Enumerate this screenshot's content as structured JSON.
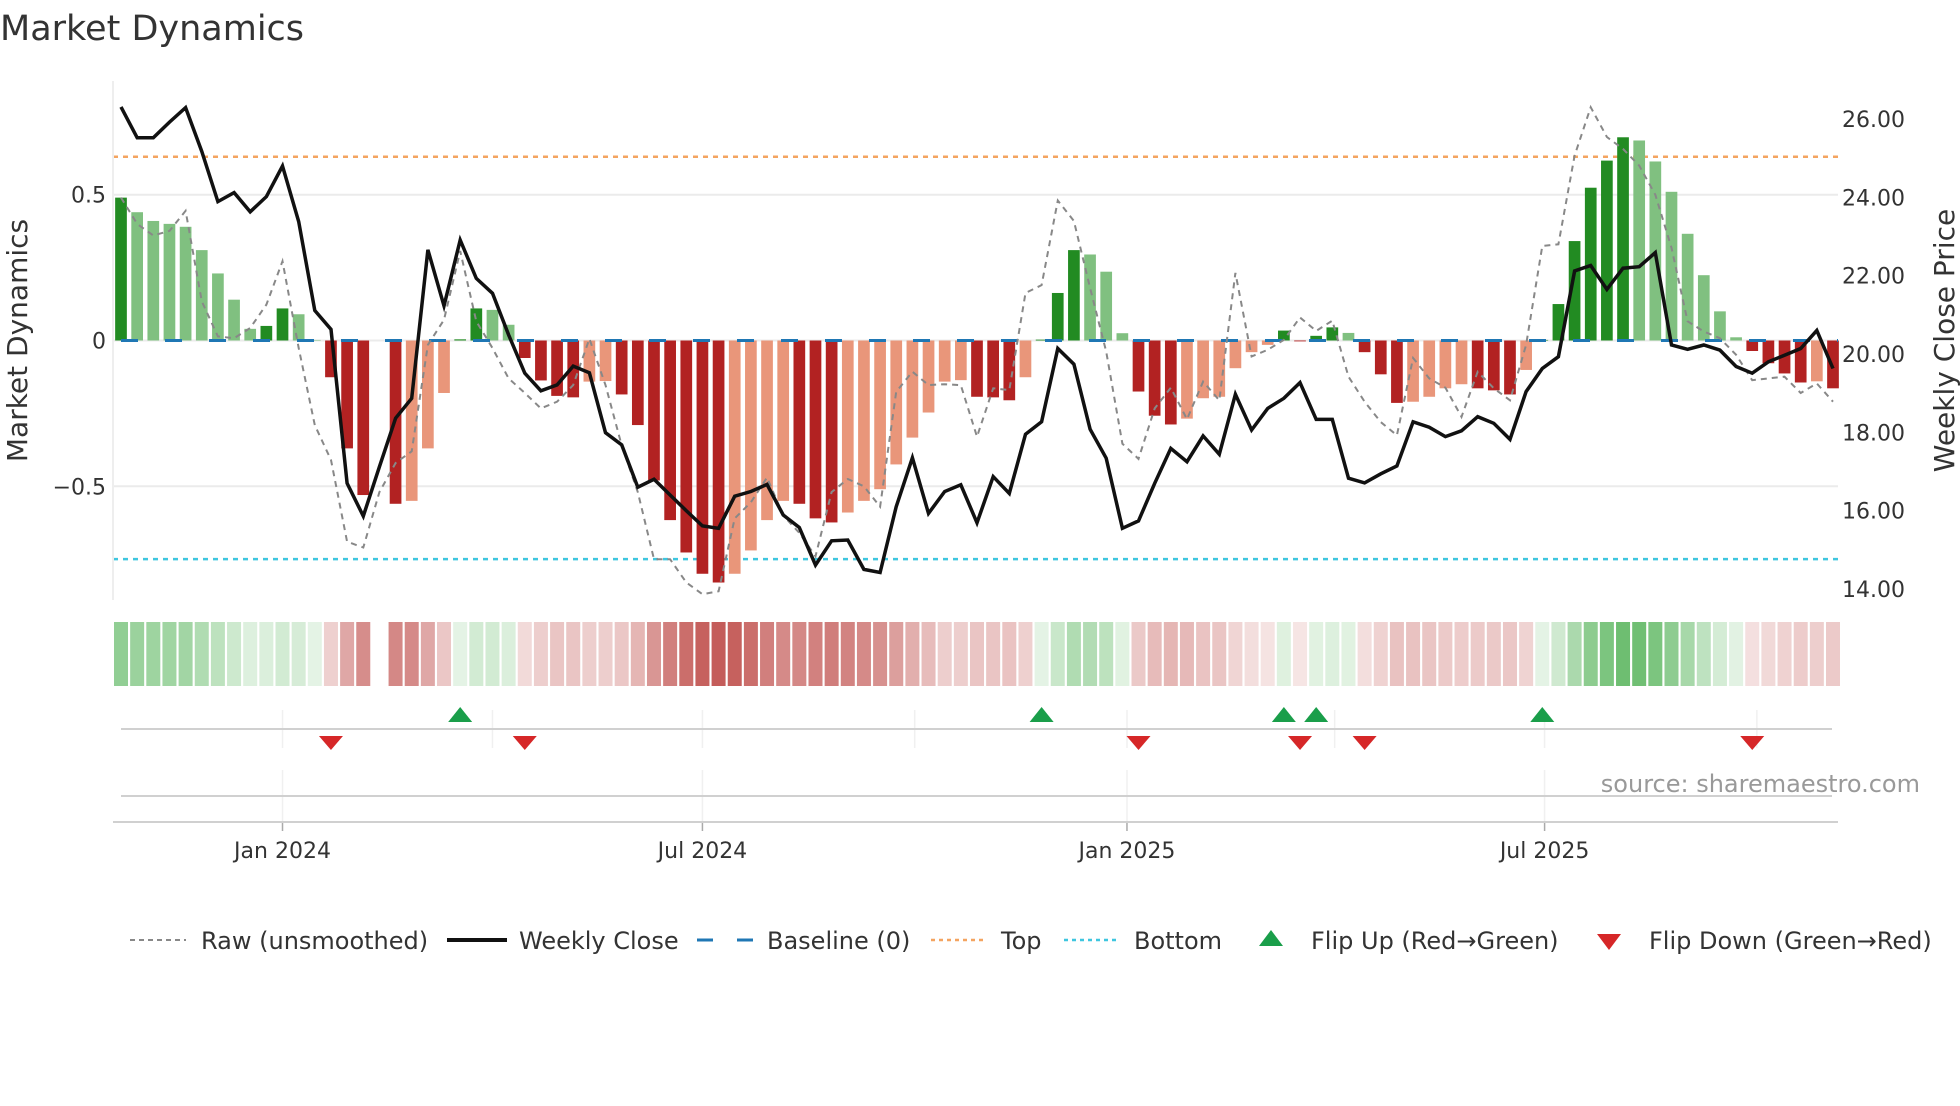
{
  "chart_data": {
    "type": "bar",
    "title": "Market Dynamics",
    "ylabel": "Market Dynamics",
    "ylabel_right": "Weekly Close Price",
    "ylim": [
      -0.89,
      0.89
    ],
    "ylim_right": [
      14.0,
      26.0
    ],
    "start_date": "2023-10-23",
    "frequency": "weekly",
    "left_ticks": [
      {
        "value": 0.5,
        "label": "0.5"
      },
      {
        "value": 0,
        "label": "0"
      },
      {
        "value": -0.5,
        "label": "−0.5"
      }
    ],
    "right_ticks": [
      {
        "value": 26,
        "label": "26.00"
      },
      {
        "value": 24,
        "label": "24.00"
      },
      {
        "value": 22,
        "label": "22.00"
      },
      {
        "value": 20,
        "label": "20.00"
      },
      {
        "value": 18,
        "label": "18.00"
      },
      {
        "value": 16,
        "label": "16.00"
      },
      {
        "value": 14,
        "label": "14.00"
      }
    ],
    "x_ticks": [
      {
        "date": "2024-01-01",
        "label": "Jan 2024"
      },
      {
        "date": "2024-07-01",
        "label": "Jul 2024"
      },
      {
        "date": "2025-01-01",
        "label": "Jan 2025"
      },
      {
        "date": "2025-07-01",
        "label": "Jul 2025"
      }
    ],
    "quarter_grid": [
      "2024-01-01",
      "2024-04-01",
      "2024-07-01",
      "2024-10-01",
      "2025-01-01",
      "2025-04-01",
      "2025-07-01",
      "2025-10-01"
    ],
    "top_level": 0.63,
    "bottom_level": -0.75,
    "baseline": 0,
    "series": [
      {
        "name": "Market Dynamics",
        "kind": "bar",
        "values": [
          0.49,
          0.44,
          0.41,
          0.4,
          0.39,
          0.31,
          0.23,
          0.14,
          0.04,
          0.05,
          0.11,
          0.09,
          0.002,
          -0.126,
          -0.37,
          -0.53,
          null,
          -0.56,
          -0.55,
          -0.37,
          -0.18,
          0.004,
          0.11,
          0.105,
          0.054,
          -0.06,
          -0.137,
          -0.19,
          -0.195,
          -0.141,
          -0.139,
          -0.185,
          -0.29,
          -0.48,
          -0.616,
          -0.727,
          -0.8,
          -0.83,
          -0.8,
          -0.72,
          -0.616,
          -0.55,
          -0.56,
          -0.61,
          -0.624,
          -0.59,
          -0.55,
          -0.51,
          -0.425,
          -0.333,
          -0.247,
          -0.141,
          -0.136,
          -0.193,
          -0.195,
          -0.205,
          -0.126,
          0.003,
          0.163,
          0.31,
          0.295,
          0.236,
          0.025,
          -0.175,
          -0.258,
          -0.288,
          -0.268,
          -0.198,
          -0.193,
          -0.095,
          -0.04,
          -0.015,
          0.034,
          -0.003,
          0.016,
          0.045,
          0.026,
          -0.04,
          -0.116,
          -0.214,
          -0.21,
          -0.193,
          -0.164,
          -0.15,
          -0.164,
          -0.171,
          -0.185,
          -0.101,
          0.002,
          0.125,
          0.341,
          0.524,
          0.617,
          0.697,
          0.686,
          0.614,
          0.51,
          0.366,
          0.224,
          0.1,
          0.011,
          -0.036,
          -0.078,
          -0.113,
          -0.144,
          -0.14,
          -0.164
        ]
      },
      {
        "name": "Raw (unsmoothed)",
        "kind": "line",
        "values": [
          0.49,
          0.4,
          0.36,
          0.376,
          0.445,
          0.134,
          0.014,
          0.008,
          0.043,
          0.123,
          0.272,
          -0.026,
          -0.29,
          -0.41,
          -0.69,
          -0.71,
          -0.52,
          -0.42,
          -0.38,
          -0.015,
          0.071,
          0.307,
          0.066,
          -0.026,
          -0.13,
          -0.18,
          -0.233,
          -0.21,
          -0.153,
          0.006,
          -0.153,
          -0.36,
          -0.52,
          -0.75,
          -0.75,
          -0.83,
          -0.87,
          -0.86,
          -0.61,
          -0.555,
          -0.47,
          -0.6,
          -0.66,
          -0.74,
          -0.52,
          -0.475,
          -0.5,
          -0.57,
          -0.176,
          -0.107,
          -0.153,
          -0.15,
          -0.153,
          -0.33,
          -0.164,
          -0.17,
          0.163,
          0.19,
          0.48,
          0.41,
          0.18,
          -0.038,
          -0.354,
          -0.406,
          -0.233,
          -0.162,
          -0.27,
          -0.141,
          -0.205,
          0.232,
          -0.055,
          -0.032,
          0.002,
          0.079,
          0.033,
          0.068,
          -0.124,
          -0.21,
          -0.28,
          -0.325,
          -0.06,
          -0.13,
          -0.162,
          -0.262,
          -0.107,
          -0.164,
          -0.205,
          -0.015,
          0.324,
          0.33,
          0.634,
          0.8,
          0.698,
          0.657,
          0.6,
          0.5,
          0.318,
          0.066,
          0.031,
          0.008,
          -0.049,
          -0.136,
          -0.13,
          -0.124,
          -0.18,
          -0.147,
          -0.21
        ]
      },
      {
        "name": "Weekly Close",
        "kind": "line",
        "axis": "right",
        "values": [
          26.31,
          25.52,
          25.52,
          25.92,
          26.29,
          25.17,
          23.89,
          24.12,
          23.63,
          24.02,
          24.8,
          23.38,
          21.11,
          20.63,
          16.7,
          15.86,
          17.12,
          18.36,
          18.87,
          22.66,
          21.23,
          22.91,
          21.93,
          21.55,
          20.49,
          19.51,
          19.06,
          19.21,
          19.69,
          19.52,
          17.99,
          17.68,
          16.6,
          16.8,
          16.4,
          16.0,
          15.61,
          15.55,
          16.37,
          16.49,
          16.67,
          15.89,
          15.57,
          14.61,
          15.23,
          15.25,
          14.5,
          14.42,
          16.1,
          17.35,
          15.93,
          16.49,
          16.66,
          15.69,
          16.87,
          16.44,
          17.95,
          18.27,
          20.14,
          19.74,
          18.08,
          17.34,
          15.55,
          15.74,
          16.7,
          17.59,
          17.25,
          17.91,
          17.44,
          18.97,
          18.06,
          18.61,
          18.87,
          19.27,
          18.33,
          18.33,
          16.83,
          16.71,
          16.94,
          17.14,
          18.27,
          18.13,
          17.89,
          18.04,
          18.4,
          18.23,
          17.82,
          19.04,
          19.63,
          19.93,
          22.12,
          22.26,
          21.65,
          22.19,
          22.23,
          22.59,
          20.23,
          20.12,
          20.23,
          20.1,
          19.68,
          19.51,
          19.8,
          19.97,
          20.14,
          20.6,
          19.63
        ]
      }
    ],
    "flip_up_indices": [
      21,
      57,
      72,
      74,
      88
    ],
    "flip_down_indices": [
      13,
      25,
      63,
      73,
      77,
      101
    ],
    "legend": {
      "placement": "bottom",
      "items": [
        {
          "key": "raw",
          "label": "Raw (unsmoothed)"
        },
        {
          "key": "close",
          "label": "Weekly Close"
        },
        {
          "key": "baseline",
          "label": "Baseline (0)"
        },
        {
          "key": "top",
          "label": "Top"
        },
        {
          "key": "bottom",
          "label": "Bottom"
        },
        {
          "key": "flip_up",
          "label": "Flip Up (Red→Green)"
        },
        {
          "key": "flip_down",
          "label": "Flip Down (Green→Red)"
        }
      ]
    },
    "source": "source: sharemaestro.com",
    "colors": {
      "green_strong": "#228b22",
      "green_weak": "#80c080",
      "red_strong": "#b22222",
      "red_weak": "#e9967a",
      "baseline": "#1f77b4",
      "top": "#f4a460",
      "bottom": "#3ec6df",
      "raw": "#888888",
      "close": "#111111",
      "flip_up": "#1a9e4a",
      "flip_down": "#d62728",
      "heat_green": "#4caf50",
      "heat_red": "#c0504d"
    }
  }
}
